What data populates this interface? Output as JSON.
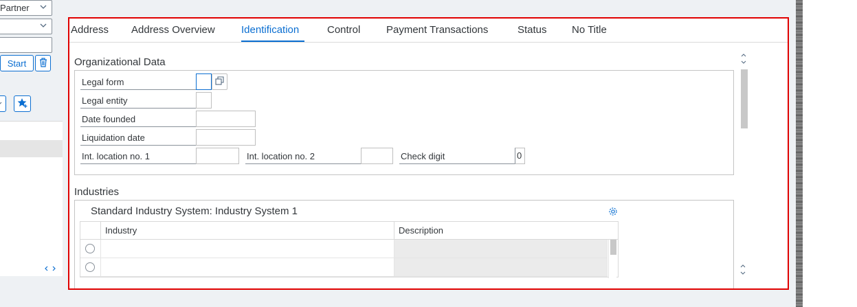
{
  "left": {
    "partner_select": "Partner",
    "start_label": "Start",
    "icons": {
      "trash": "trash-icon",
      "favorite": "favorite-add-icon"
    }
  },
  "tabs": [
    {
      "label": "Address"
    },
    {
      "label": "Address Overview"
    },
    {
      "label": "Identification",
      "active": true
    },
    {
      "label": "Control"
    },
    {
      "label": "Payment Transactions"
    },
    {
      "label": "Status"
    },
    {
      "label": "No Title"
    }
  ],
  "org": {
    "title": "Organizational Data",
    "legal_form_label": "Legal form",
    "legal_form_value": "",
    "legal_entity_label": "Legal entity",
    "legal_entity_value": "",
    "date_founded_label": "Date founded",
    "date_founded_value": "",
    "liquidation_date_label": "Liquidation date",
    "liquidation_date_value": "",
    "int_loc1_label": "Int. location no. 1",
    "int_loc1_value": "",
    "int_loc2_label": "Int. location no. 2",
    "int_loc2_value": "",
    "check_digit_label": "Check digit",
    "check_digit_value": "0"
  },
  "industries": {
    "title": "Industries",
    "table_title": "Standard Industry System: Industry System 1",
    "columns": [
      "Industry",
      "Description"
    ],
    "rows": [
      {
        "industry": "",
        "description": ""
      },
      {
        "industry": "",
        "description": ""
      }
    ]
  },
  "colors": {
    "accent": "#0a6ed1",
    "highlight_border": "#e00000"
  }
}
